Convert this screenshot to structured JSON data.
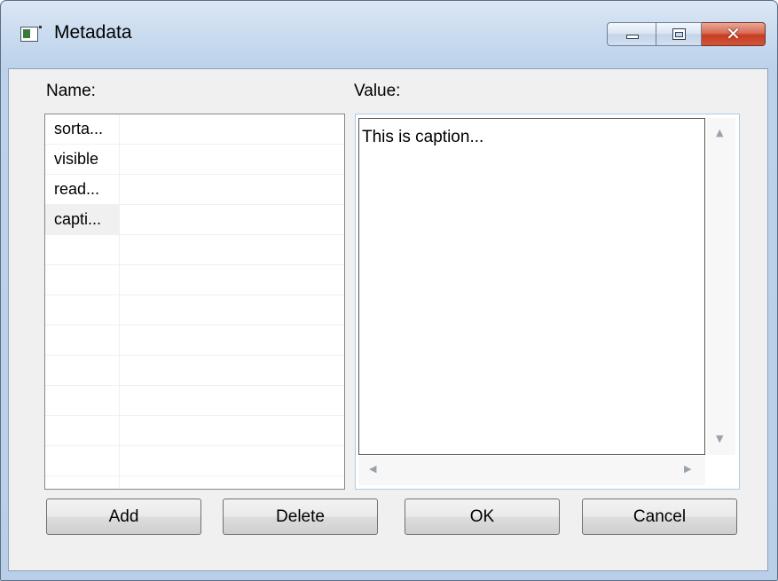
{
  "window": {
    "title": "Metadata",
    "icon": "app-window-icon",
    "controls": {
      "minimize": "minimize-icon",
      "maximize": "maximize-icon",
      "close": "close-icon",
      "close_glyph": "✕"
    }
  },
  "name_label": "Name:",
  "value_label": "Value:",
  "names": [
    {
      "label": "sorta...",
      "selected": false
    },
    {
      "label": "visible",
      "selected": false
    },
    {
      "label": "read...",
      "selected": false
    },
    {
      "label": "capti...",
      "selected": true
    }
  ],
  "value_text": "This is caption...",
  "scroll_glyphs": {
    "up": "▲",
    "down": "▼",
    "left": "◀",
    "right": "▶"
  },
  "buttons": {
    "add": "Add",
    "delete": "Delete",
    "ok": "OK",
    "cancel": "Cancel"
  }
}
